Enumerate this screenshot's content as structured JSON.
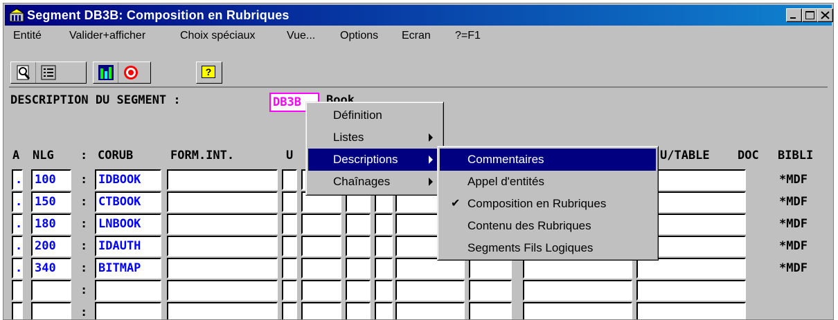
{
  "window": {
    "title": "Segment DB3B: Composition en Rubriques"
  },
  "menubar": {
    "items": [
      "Entité",
      "Valider+afficher",
      "Choix spéciaux",
      "Vue...",
      "Options",
      "Ecran",
      "?=F1"
    ]
  },
  "toolbar": {
    "icons": [
      "magnify-doc-icon",
      "list-icon",
      "chart-icon",
      "target-icon",
      "help-icon"
    ],
    "help_glyph": "?"
  },
  "screen": {
    "desc_label": "DESCRIPTION DU SEGMENT :",
    "segment_code": "DB3B",
    "segment_name_visible": "Book",
    "headers": {
      "a": "A",
      "nlg": "NLG",
      "colon": ":",
      "corub": "CORUB",
      "formint": "FORM.INT.",
      "u": "U",
      "ujtable": "U/TABLE",
      "doc": "DOC",
      "bibli": "BIBLI"
    },
    "rows": [
      {
        "a": ".",
        "nlg": "100",
        "corub": "IDBOOK",
        "bibli": "*MDF"
      },
      {
        "a": ".",
        "nlg": "150",
        "corub": "CTBOOK",
        "bibli": "*MDF"
      },
      {
        "a": ".",
        "nlg": "180",
        "corub": "LNBOOK",
        "bibli": "*MDF"
      },
      {
        "a": ".",
        "nlg": "200",
        "corub": "IDAUTH",
        "bibli": "*MDF"
      },
      {
        "a": ".",
        "nlg": "340",
        "corub": "BITMAP",
        "bibli": "*MDF"
      },
      {
        "a": "",
        "nlg": "",
        "corub": "",
        "bibli": ""
      },
      {
        "a": "",
        "nlg": "",
        "corub": "",
        "bibli": ""
      }
    ]
  },
  "context_menu": {
    "items": [
      "Définition",
      "Listes",
      "Descriptions",
      "Chaînages"
    ],
    "selected": "Descriptions"
  },
  "submenu": {
    "items": [
      "Commentaires",
      "Appel d'entités",
      "Composition en Rubriques",
      "Contenu des Rubriques",
      "Segments Fils Logiques"
    ],
    "highlighted": "Commentaires",
    "checked": "Composition en Rubriques",
    "check_glyph": "✔"
  },
  "colors": {
    "title_bar": "#000080",
    "field_text": "#0000ff",
    "segment_code": "#ff00ff",
    "highlight": "#000080"
  }
}
